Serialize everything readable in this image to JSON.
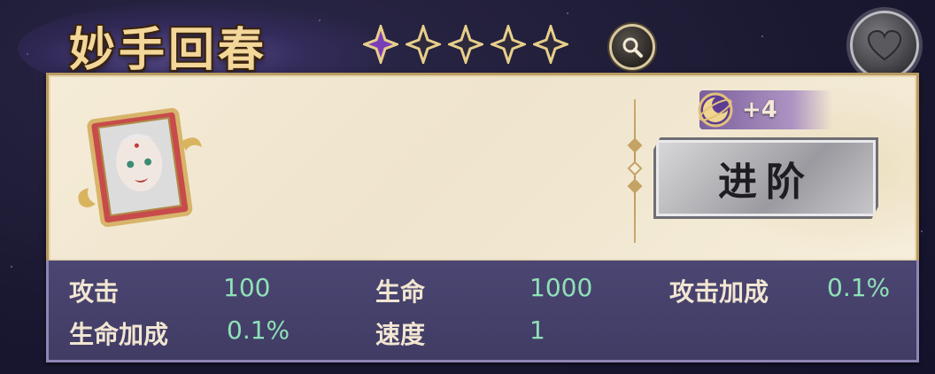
{
  "title": "妙手回春",
  "rank": {
    "total": 5,
    "filled": 1
  },
  "icons": {
    "search": "magnifier-icon",
    "favorite": "heart-icon",
    "level": "orbit-moon-icon"
  },
  "colors": {
    "accent_gold": "#f3d79a",
    "stat_value": "#8fe1b7",
    "panel_purple": "#4b4672"
  },
  "level_badge": {
    "value": "+4"
  },
  "advance_button": {
    "label": "进阶"
  },
  "stats": [
    {
      "label": "攻击",
      "value": "100"
    },
    {
      "label": "生命",
      "value": "1000"
    },
    {
      "label": "攻击加成",
      "value": "0.1%"
    },
    {
      "label": "生命加成",
      "value": "0.1%"
    },
    {
      "label": "速度",
      "value": "1"
    }
  ]
}
